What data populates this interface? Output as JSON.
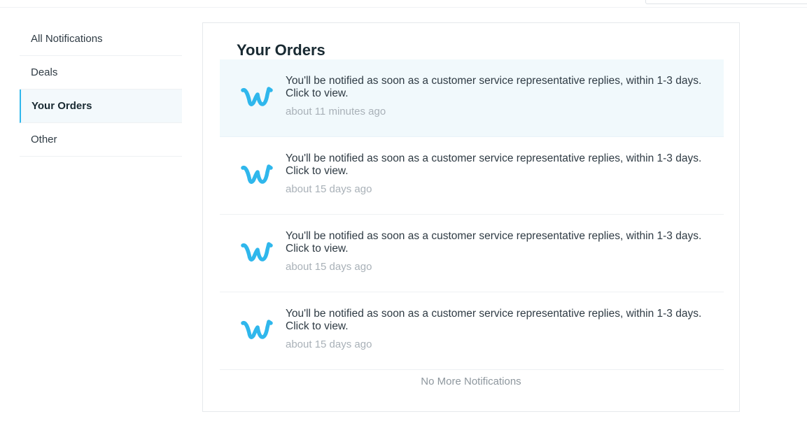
{
  "sidebar": {
    "items": [
      {
        "label": "All Notifications",
        "active": false
      },
      {
        "label": "Deals",
        "active": false
      },
      {
        "label": "Your Orders",
        "active": true
      },
      {
        "label": "Other",
        "active": false
      }
    ]
  },
  "main": {
    "title": "Your Orders",
    "notifications": [
      {
        "message": "You'll be notified as soon as a customer service representative replies, within 1-3 days. Click to view.",
        "time": "about 11 minutes ago",
        "unread": true,
        "icon": "wish-logo-icon"
      },
      {
        "message": "You'll be notified as soon as a customer service representative replies, within 1-3 days. Click to view.",
        "time": "about 15 days ago",
        "unread": false,
        "icon": "wish-logo-icon"
      },
      {
        "message": "You'll be notified as soon as a customer service representative replies, within 1-3 days. Click to view.",
        "time": "about 15 days ago",
        "unread": false,
        "icon": "wish-logo-icon"
      },
      {
        "message": "You'll be notified as soon as a customer service representative replies, within 1-3 days. Click to view.",
        "time": "about 15 days ago",
        "unread": false,
        "icon": "wish-logo-icon"
      }
    ],
    "footer": "No More Notifications"
  },
  "colors": {
    "accent": "#2fb7ec",
    "unread_bg": "#f1f9fc",
    "text": "#2f3b44",
    "muted": "#a9b1b8"
  }
}
